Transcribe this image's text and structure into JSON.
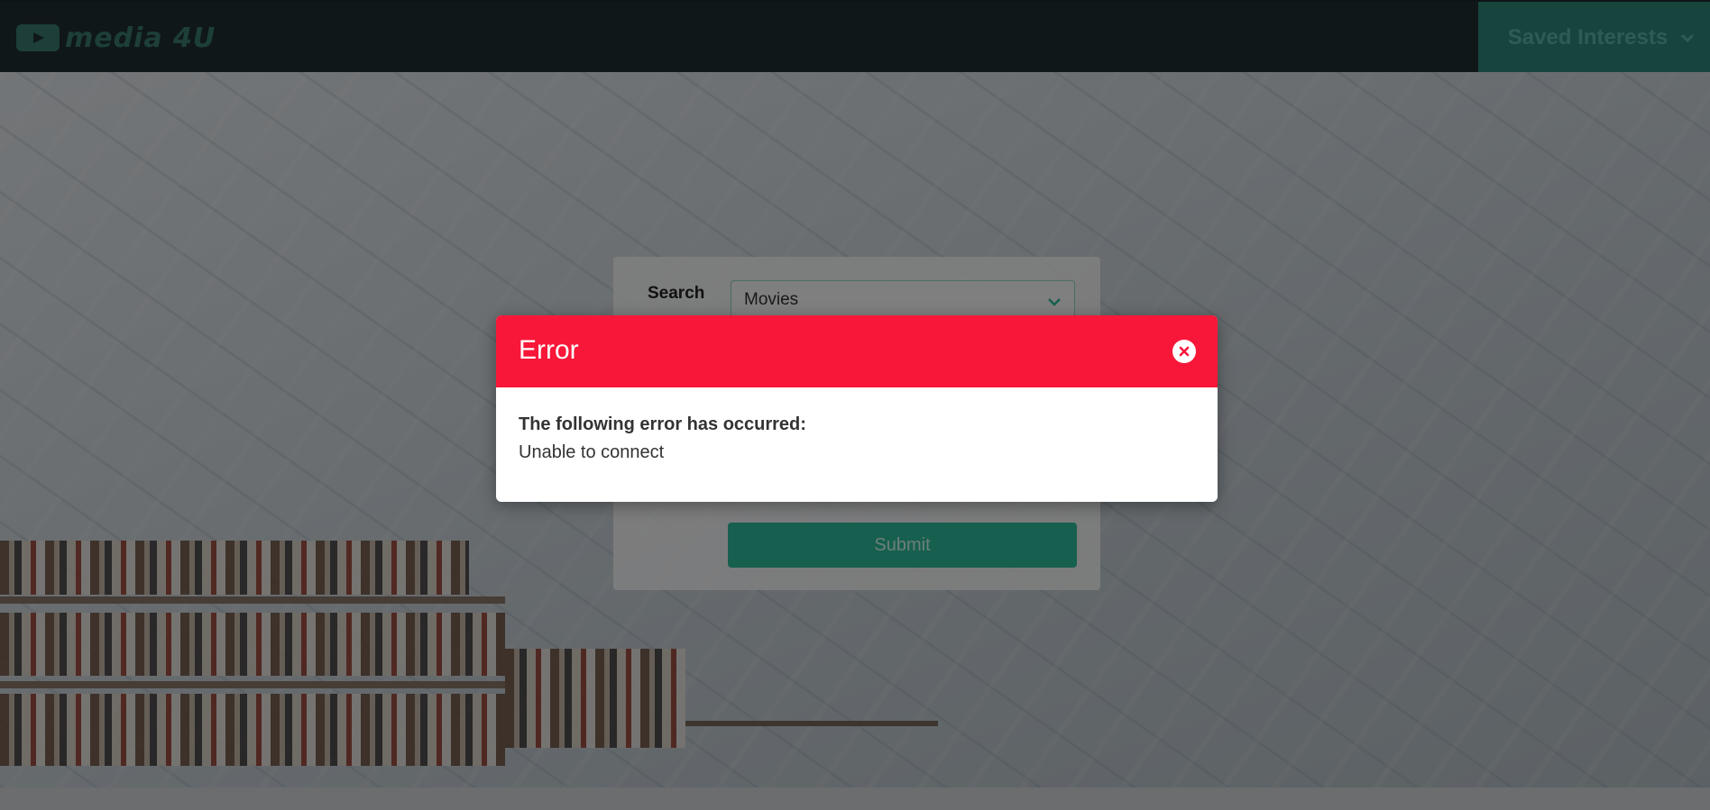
{
  "header": {
    "logo_text": "media 4U",
    "logo_icon": "play-icon",
    "saved_interests_label": "Saved Interests",
    "saved_interests_icon": "chevron-down-icon"
  },
  "search_form": {
    "label": "Search",
    "select_value": "Movies",
    "submit_label": "Submit"
  },
  "modal": {
    "title": "Error",
    "close_icon": "close-icon",
    "heading": "The following error has occurred:",
    "message": "Unable to connect"
  },
  "colors": {
    "header_bg": "#1f2f33",
    "accent": "#2fbf9e",
    "error_red": "#f81738"
  }
}
